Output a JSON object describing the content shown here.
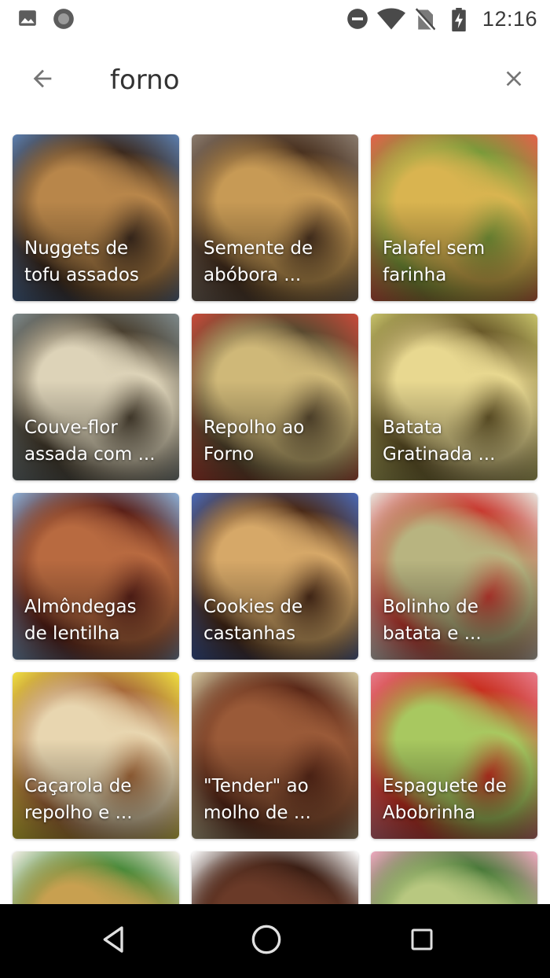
{
  "status_bar": {
    "time": "12:16",
    "icons": [
      "image-notification-icon",
      "circle-notification-icon",
      "do-not-disturb-icon",
      "wifi-icon",
      "no-sim-icon",
      "battery-charging-icon"
    ]
  },
  "search": {
    "value": "forno",
    "back_icon": "arrow-back-icon",
    "clear_icon": "close-icon"
  },
  "results": [
    {
      "title": "Nuggets de\ntofu assados",
      "palette": [
        "#5b7fb0",
        "#b8864a",
        "#3c2a1e"
      ]
    },
    {
      "title": "Semente de\nabóbora ...",
      "palette": [
        "#8a7b6e",
        "#c79a55",
        "#4a3220"
      ]
    },
    {
      "title": "Falafel sem\nfarinha",
      "palette": [
        "#e4604a",
        "#d9b450",
        "#7a9a3a"
      ]
    },
    {
      "title": " Couve-flor\nassada com ...",
      "palette": [
        "#7e8a8c",
        "#ddd3b8",
        "#4a4030"
      ]
    },
    {
      "title": "Repolho ao\nForno",
      "palette": [
        "#c94a3a",
        "#cfb878",
        "#5a4a30"
      ]
    },
    {
      "title": "Batata\nGratinada ...",
      "palette": [
        "#c7c26a",
        "#e8d890",
        "#6a5a2a"
      ]
    },
    {
      "title": "Almôndegas\nde lentilha",
      "palette": [
        "#8cb0d8",
        "#b86a40",
        "#5a2018"
      ]
    },
    {
      "title": "Cookies de\ncastanhas",
      "palette": [
        "#4a6ab8",
        "#d6a868",
        "#4a2a18"
      ]
    },
    {
      "title": "Bolinho de\nbatata e ...",
      "palette": [
        "#e8e4dc",
        "#b8b480",
        "#c83a30"
      ]
    },
    {
      "title": "Caçarola de\nrepolho e ...",
      "palette": [
        "#f0e040",
        "#e8d6b0",
        "#a86a3a"
      ]
    },
    {
      "title": "\"Tender\" ao\nmolho de ...",
      "palette": [
        "#d4c8a0",
        "#9a5a38",
        "#5a2818"
      ]
    },
    {
      "title": "Espaguete de\nAbobrinha",
      "palette": [
        "#e87a8a",
        "#a8c860",
        "#c83020"
      ]
    },
    {
      "title": "",
      "palette": [
        "#f4f0e8",
        "#c8a050",
        "#4a8a3a"
      ]
    },
    {
      "title": "",
      "palette": [
        "#ffffff",
        "#6a3a28",
        "#3a1e14"
      ]
    },
    {
      "title": "",
      "palette": [
        "#f0a8c0",
        "#b8c880",
        "#4a7a3a"
      ]
    }
  ],
  "nav_bar": {
    "icons": [
      "nav-back-icon",
      "nav-home-icon",
      "nav-recents-icon"
    ]
  }
}
